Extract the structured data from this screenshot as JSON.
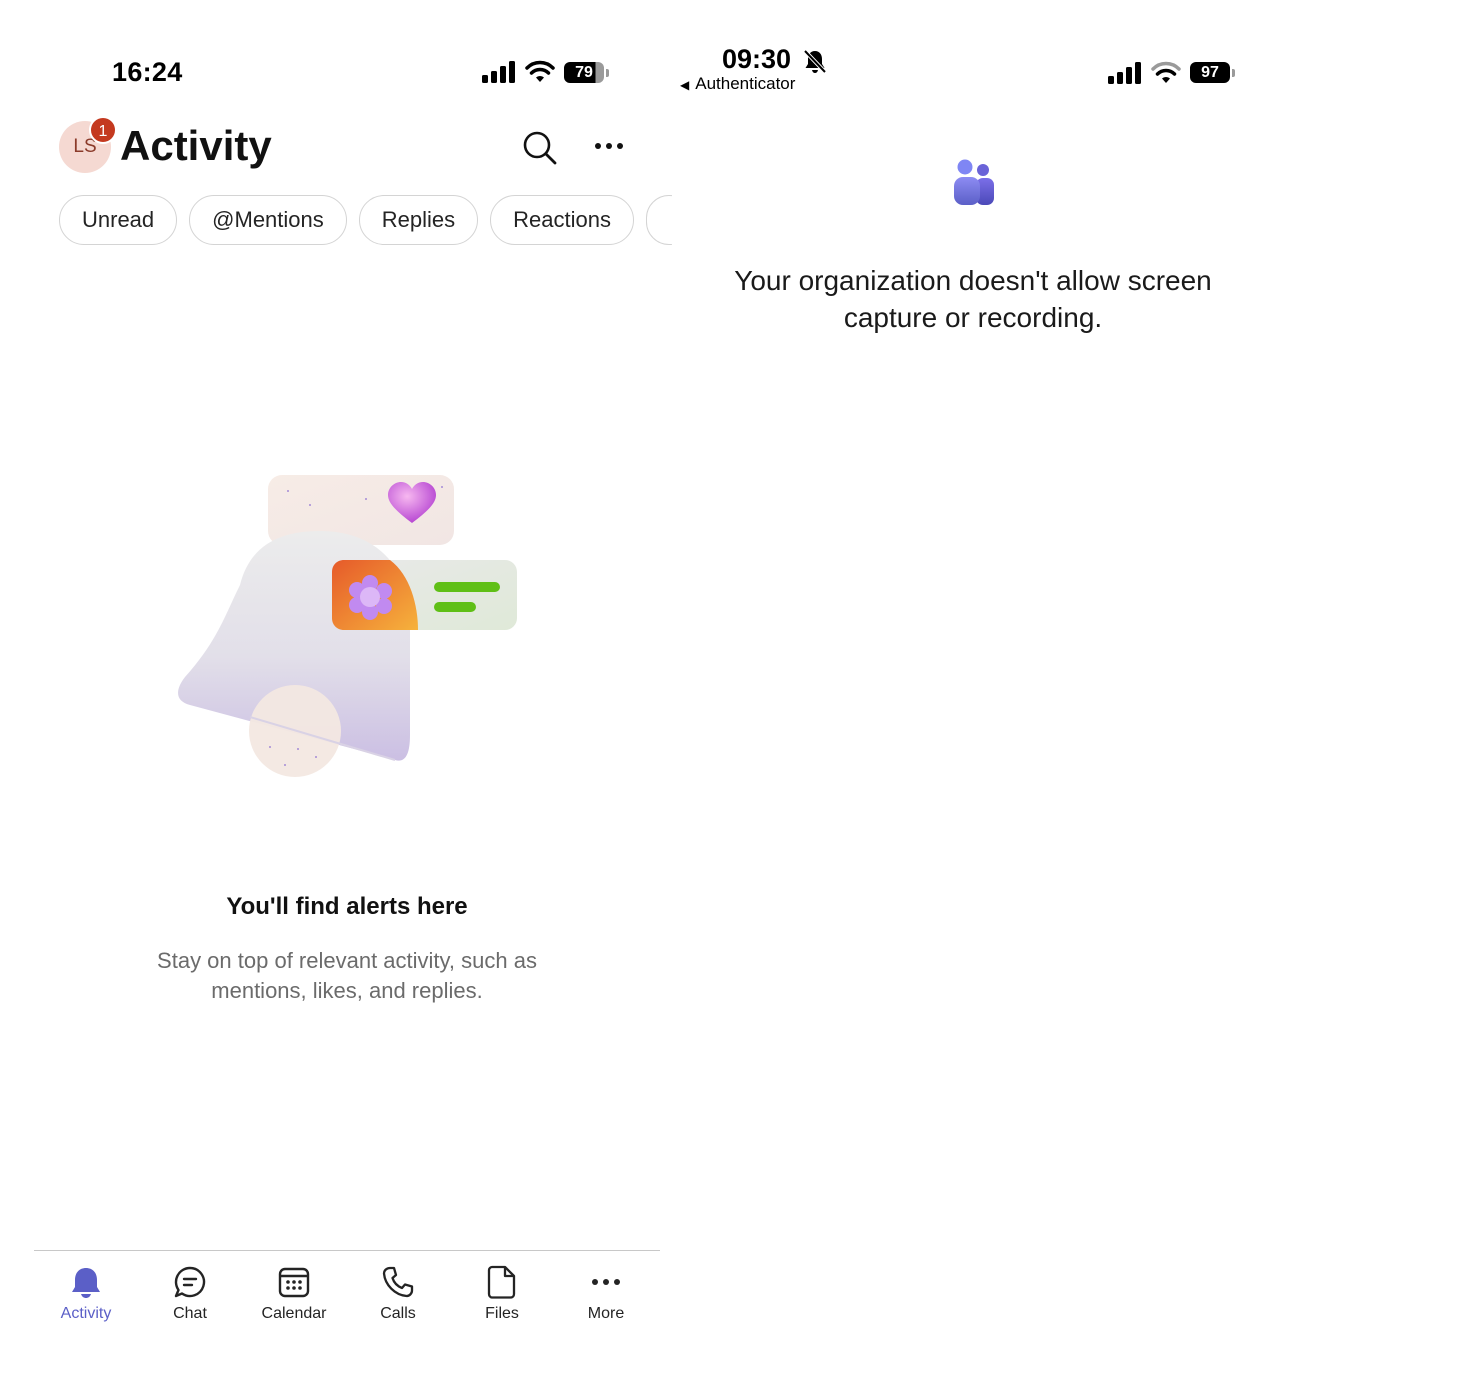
{
  "left": {
    "status_bar": {
      "time": "16:24",
      "battery": "79"
    },
    "header": {
      "avatar_initials": "LS",
      "avatar_badge": "1",
      "title": "Activity"
    },
    "filters": [
      "Unread",
      "@Mentions",
      "Replies",
      "Reactions",
      ""
    ],
    "empty_state": {
      "title": "You'll find alerts here",
      "subtitle": "Stay on top of relevant activity, such as mentions, likes, and replies."
    },
    "tabs": [
      {
        "label": "Activity",
        "icon": "bell-icon",
        "active": true
      },
      {
        "label": "Chat",
        "icon": "chat-icon",
        "active": false
      },
      {
        "label": "Calendar",
        "icon": "calendar-icon",
        "active": false
      },
      {
        "label": "Calls",
        "icon": "phone-icon",
        "active": false
      },
      {
        "label": "Files",
        "icon": "file-icon",
        "active": false
      },
      {
        "label": "More",
        "icon": "more-icon",
        "active": false
      }
    ],
    "colors": {
      "accent": "#5b5fc7",
      "badge": "#c4391f"
    }
  },
  "right": {
    "status_bar": {
      "time": "09:30",
      "back_app": "Authenticator",
      "battery": "97"
    },
    "message": "Your organization doesn't allow screen capture or recording."
  }
}
